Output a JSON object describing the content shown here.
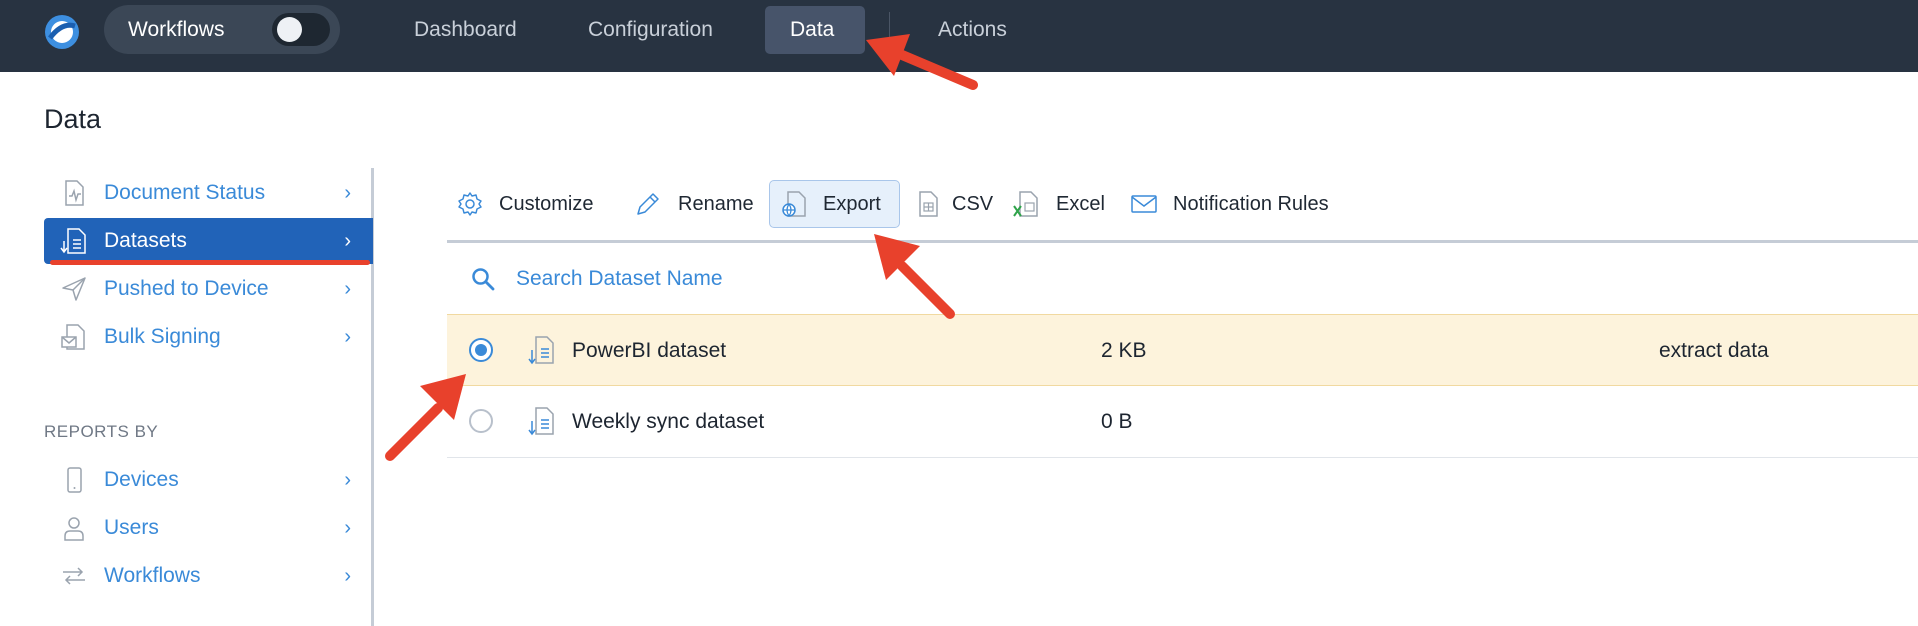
{
  "topnav": {
    "workflows_label": "Workflows",
    "items": [
      {
        "label": "Dashboard"
      },
      {
        "label": "Configuration"
      },
      {
        "label": "Data"
      },
      {
        "label": "Actions"
      }
    ],
    "active": "Data"
  },
  "page": {
    "title": "Data"
  },
  "sidebar": {
    "items": [
      {
        "label": "Document Status",
        "icon": "document-status-icon"
      },
      {
        "label": "Datasets",
        "icon": "dataset-icon",
        "active": true
      },
      {
        "label": "Pushed to Device",
        "icon": "send-icon"
      },
      {
        "label": "Bulk Signing",
        "icon": "bulk-signing-icon"
      }
    ],
    "reports_heading": "REPORTS BY",
    "reports": [
      {
        "label": "Devices",
        "icon": "device-icon"
      },
      {
        "label": "Users",
        "icon": "user-icon"
      },
      {
        "label": "Workflows",
        "icon": "workflow-icon"
      }
    ],
    "chevron": "›"
  },
  "toolbar": {
    "customize": "Customize",
    "rename": "Rename",
    "export": "Export",
    "csv": "CSV",
    "excel": "Excel",
    "notification_rules": "Notification Rules"
  },
  "search": {
    "placeholder": "Search Dataset Name"
  },
  "datasets": [
    {
      "name": "PowerBI dataset",
      "size": "2 KB",
      "note": "extract data",
      "selected": true
    },
    {
      "name": "Weekly sync dataset",
      "size": "0 B",
      "note": "",
      "selected": false
    }
  ],
  "colors": {
    "topbar": "#283341",
    "accent": "#3a8ad8",
    "active_sidebar": "#2163b8",
    "selected_row": "#fdf3dc",
    "annotation_arrow": "#e8412c"
  }
}
